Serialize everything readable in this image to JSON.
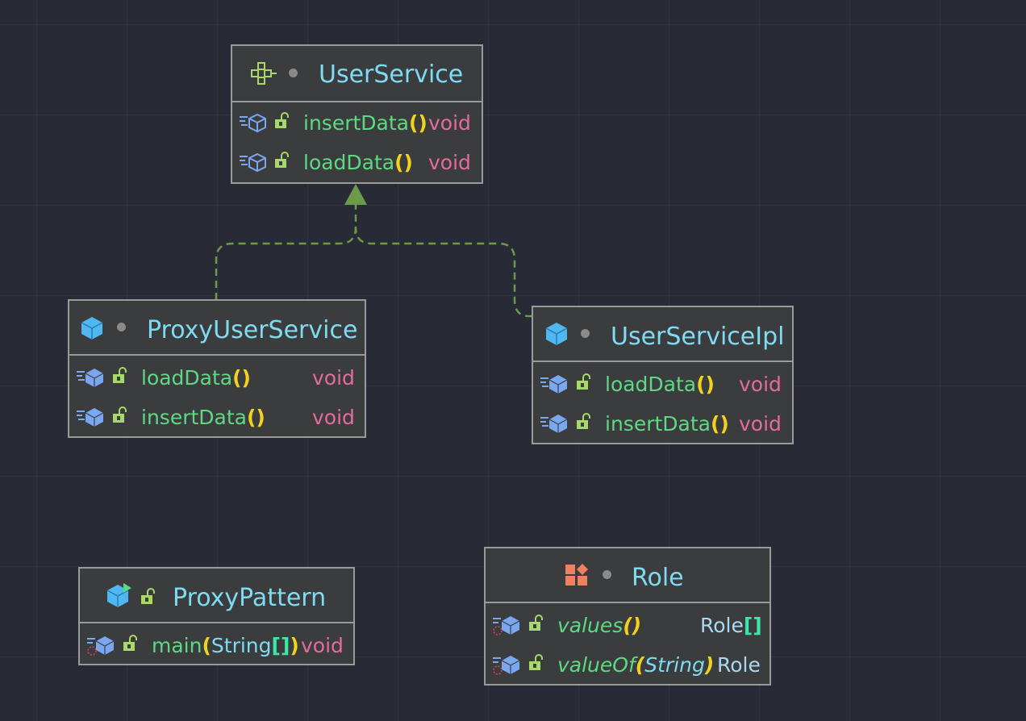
{
  "colors": {
    "background": "#282a35",
    "node_fill": "#3b3c3e",
    "node_border": "#9a9a9a",
    "class_name": "#7fdbf2",
    "method_name": "#5fd884",
    "parens": "#f2d21b",
    "return_void": "#e46ba0",
    "return_class": "#a9d8ef",
    "edge": "#6a9a4a"
  },
  "nodes": {
    "user_service": {
      "name": "UserService",
      "kind_icon": "interface-icon",
      "methods": [
        {
          "name": "insertData",
          "paren": "()",
          "type": "void"
        },
        {
          "name": "loadData",
          "paren": "()",
          "type": "void"
        }
      ]
    },
    "proxy_user_service": {
      "name": "ProxyUserService",
      "kind_icon": "class-icon",
      "methods": [
        {
          "name": "loadData",
          "paren": "()",
          "type": "void"
        },
        {
          "name": "insertData",
          "paren": "()",
          "type": "void"
        }
      ]
    },
    "user_service_ipl": {
      "name": "UserServiceIpl",
      "kind_icon": "class-icon",
      "methods": [
        {
          "name": "loadData",
          "paren": "()",
          "type": "void"
        },
        {
          "name": "insertData",
          "paren": "()",
          "type": "void"
        }
      ]
    },
    "proxy_pattern": {
      "name": "ProxyPattern",
      "kind_icon": "runnable-class-icon",
      "methods": [
        {
          "name": "main",
          "paren_open": "(",
          "param": "String",
          "bracket": "[]",
          "paren_close": ")",
          "type": "void"
        }
      ]
    },
    "role": {
      "name": "Role",
      "kind_icon": "enum-icon",
      "methods": [
        {
          "name": "values",
          "paren": "()",
          "type": "Role",
          "type_bracket": "[]"
        },
        {
          "name": "valueOf",
          "paren_open": "(",
          "param": "String",
          "paren_close": ")",
          "type": "Role"
        }
      ]
    }
  },
  "edges": [
    {
      "from": "ProxyUserService",
      "to": "UserService",
      "kind": "realization"
    },
    {
      "from": "UserServiceIpl",
      "to": "UserService",
      "kind": "realization"
    }
  ]
}
